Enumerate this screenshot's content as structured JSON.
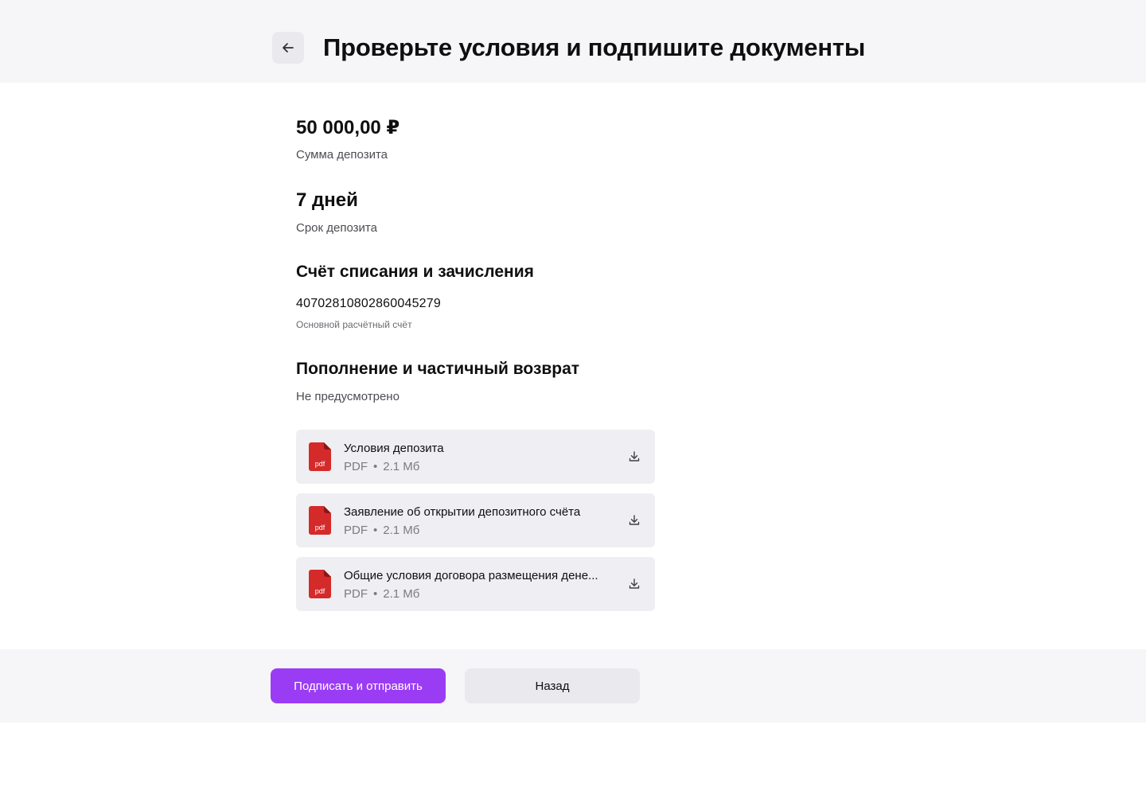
{
  "header": {
    "title": "Проверьте условия и подпишите документы",
    "back_icon": "arrow-left-icon"
  },
  "deposit": {
    "amount": "50 000,00 ₽",
    "amount_label": "Сумма депозита",
    "term": "7 дней",
    "term_label": "Срок депозита"
  },
  "account": {
    "title": "Счёт списания и зачисления",
    "number": "40702810802860045279",
    "type": "Основной расчётный счёт"
  },
  "replenishment": {
    "title": "Пополнение и частичный возврат",
    "value": "Не предусмотрено"
  },
  "documents": [
    {
      "title": "Условия депозита",
      "format": "PDF",
      "separator": "•",
      "size": "2.1 Мб",
      "icon_label": "pdf"
    },
    {
      "title": "Заявление об открытии депозитного счёта",
      "format": "PDF",
      "separator": "•",
      "size": "2.1 Мб",
      "icon_label": "pdf"
    },
    {
      "title": "Общие условия договора размещения дене...",
      "format": "PDF",
      "separator": "•",
      "size": "2.1 Мб",
      "icon_label": "pdf"
    }
  ],
  "footer": {
    "submit_label": "Подписать и отправить",
    "back_label": "Назад"
  },
  "colors": {
    "accent": "#9b3cf5",
    "pdf_red": "#d42a2a",
    "surface": "#f6f6f9",
    "card": "#efeff3"
  }
}
